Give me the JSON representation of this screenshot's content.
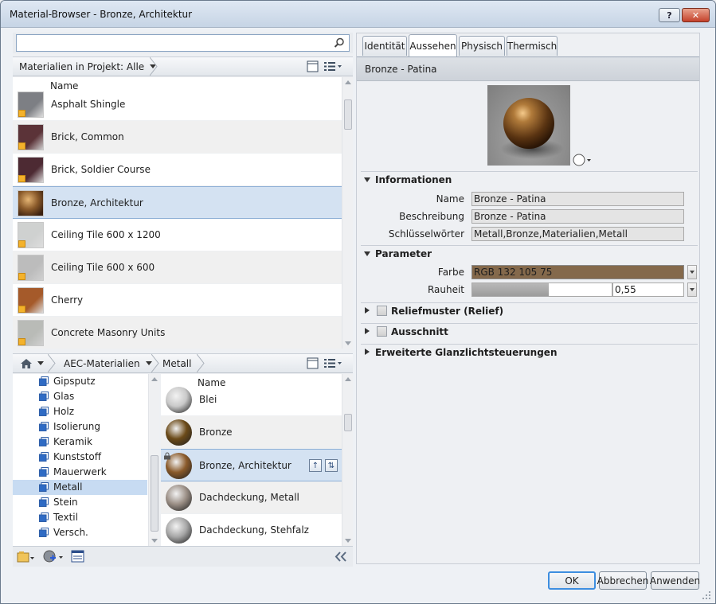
{
  "window": {
    "title": "Material-Browser - Bronze, Architektur",
    "help": "?",
    "close": "✕"
  },
  "search": {
    "value": "",
    "placeholder": ""
  },
  "project_filter": {
    "label": "Materialien in Projekt: Alle"
  },
  "project_list": {
    "column_header": "Name",
    "items": [
      {
        "label": "Asphalt Shingle",
        "swatch": "#7d7f84"
      },
      {
        "label": "Brick, Common",
        "swatch": "#5b3338"
      },
      {
        "label": "Brick, Soldier Course",
        "swatch": "#4d2a33"
      },
      {
        "label": "Bronze, Architektur",
        "swatch": "#8a5a2a",
        "selected": true
      },
      {
        "label": "Ceiling Tile 600 x 1200",
        "swatch": "#cfd1d0"
      },
      {
        "label": "Ceiling Tile 600 x 600",
        "swatch": "#bcbcbc"
      },
      {
        "label": "Cherry",
        "swatch": "#a55a2a"
      },
      {
        "label": "Concrete Masonry Units",
        "swatch": "#b9bbb7"
      }
    ]
  },
  "library_breadcrumb": {
    "root": "AEC-Materialien",
    "current": "Metall"
  },
  "categories": {
    "items": [
      {
        "label": "Gipsputz"
      },
      {
        "label": "Glas"
      },
      {
        "label": "Holz"
      },
      {
        "label": "Isolierung"
      },
      {
        "label": "Keramik"
      },
      {
        "label": "Kunststoff"
      },
      {
        "label": "Mauerwerk"
      },
      {
        "label": "Metall",
        "selected": true
      },
      {
        "label": "Stein"
      },
      {
        "label": "Textil"
      },
      {
        "label": "Versch."
      }
    ]
  },
  "library_list": {
    "column_header": "Name",
    "items": [
      {
        "label": "Blei",
        "swatch": "#c9c9c9"
      },
      {
        "label": "Bronze",
        "swatch": "#6b4a18"
      },
      {
        "label": "Bronze, Architektur",
        "swatch": "#8a5a2a",
        "selected": true
      },
      {
        "label": "Dachdeckung, Metall",
        "swatch": "#9b8f86"
      },
      {
        "label": "Dachdeckung, Stehfalz",
        "swatch": "#a7a7a7"
      }
    ]
  },
  "tabs": [
    {
      "label": "Identität"
    },
    {
      "label": "Aussehen",
      "active": true
    },
    {
      "label": "Physisch"
    },
    {
      "label": "Thermisch"
    }
  ],
  "material": {
    "name": "Bronze - Patina"
  },
  "informationen": {
    "title": "Informationen",
    "name_label": "Name",
    "name_value": "Bronze - Patina",
    "desc_label": "Beschreibung",
    "desc_value": "Bronze - Patina",
    "keys_label": "Schlüsselwörter",
    "keys_value": "Metall,Bronze,Materialien,Metall"
  },
  "parameter": {
    "title": "Parameter",
    "farbe_label": "Farbe",
    "farbe_value": "RGB 132 105 75",
    "farbe_color": "#84694b",
    "rauheit_label": "Rauheit",
    "rauheit_value": "0,55",
    "rauheit_level": 0.55
  },
  "sections": {
    "relief": "Reliefmuster (Relief)",
    "ausschnitt": "Ausschnitt",
    "glanz": "Erweiterte Glanzlichtsteuerungen"
  },
  "buttons": {
    "ok": "OK",
    "cancel": "Abbrechen",
    "apply": "Anwenden"
  }
}
